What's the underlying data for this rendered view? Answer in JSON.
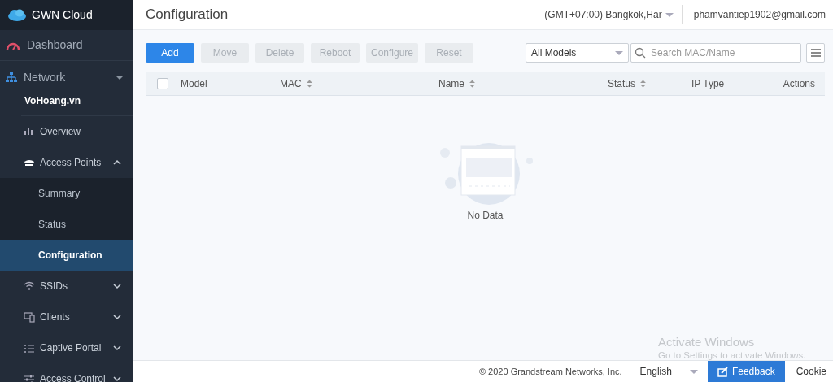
{
  "sidebar": {
    "brand": "GWN Cloud",
    "dashboard": {
      "label": "Dashboard"
    },
    "network": {
      "label": "Network",
      "site": "VoHoang.vn"
    },
    "menu": [
      {
        "label": "Overview"
      },
      {
        "label": "Access Points",
        "expanded": true,
        "children": [
          {
            "label": "Summary",
            "selected": false
          },
          {
            "label": "Status",
            "selected": false
          },
          {
            "label": "Configuration",
            "selected": true
          }
        ]
      },
      {
        "label": "SSIDs",
        "expanded": false
      },
      {
        "label": "Clients",
        "expanded": false
      },
      {
        "label": "Captive Portal",
        "expanded": false
      },
      {
        "label": "Access Control",
        "expanded": false
      }
    ]
  },
  "header": {
    "title": "Configuration",
    "timezone": "(GMT+07:00) Bangkok,Har",
    "account": "phamvantiep1902@gmail.com"
  },
  "toolbar": {
    "buttons": [
      {
        "label": "Add",
        "disabled": false
      },
      {
        "label": "Move",
        "disabled": true
      },
      {
        "label": "Delete",
        "disabled": true
      },
      {
        "label": "Reboot",
        "disabled": true
      },
      {
        "label": "Configure",
        "disabled": true
      },
      {
        "label": "Reset",
        "disabled": true
      }
    ],
    "model_filter": "All Models",
    "search": {
      "placeholder": "Search MAC/Name"
    }
  },
  "table": {
    "select_all": {
      "checked": false
    },
    "columns": [
      {
        "label": "Model",
        "sortable": false
      },
      {
        "label": "MAC",
        "sortable": true
      },
      {
        "label": "Name",
        "sortable": true
      },
      {
        "label": "Status",
        "sortable": true
      },
      {
        "label": "IP Type",
        "sortable": false
      },
      {
        "label": "Actions",
        "sortable": false
      }
    ],
    "empty_text": "No Data"
  },
  "os_notice": {
    "title": "Activate Windows",
    "text": "Go to Settings to activate Windows."
  },
  "footer": {
    "copyright": "© 2020 Grandstream Networks, Inc.",
    "language": "English",
    "feedback": "Feedback",
    "cookie": "Cookie"
  }
}
